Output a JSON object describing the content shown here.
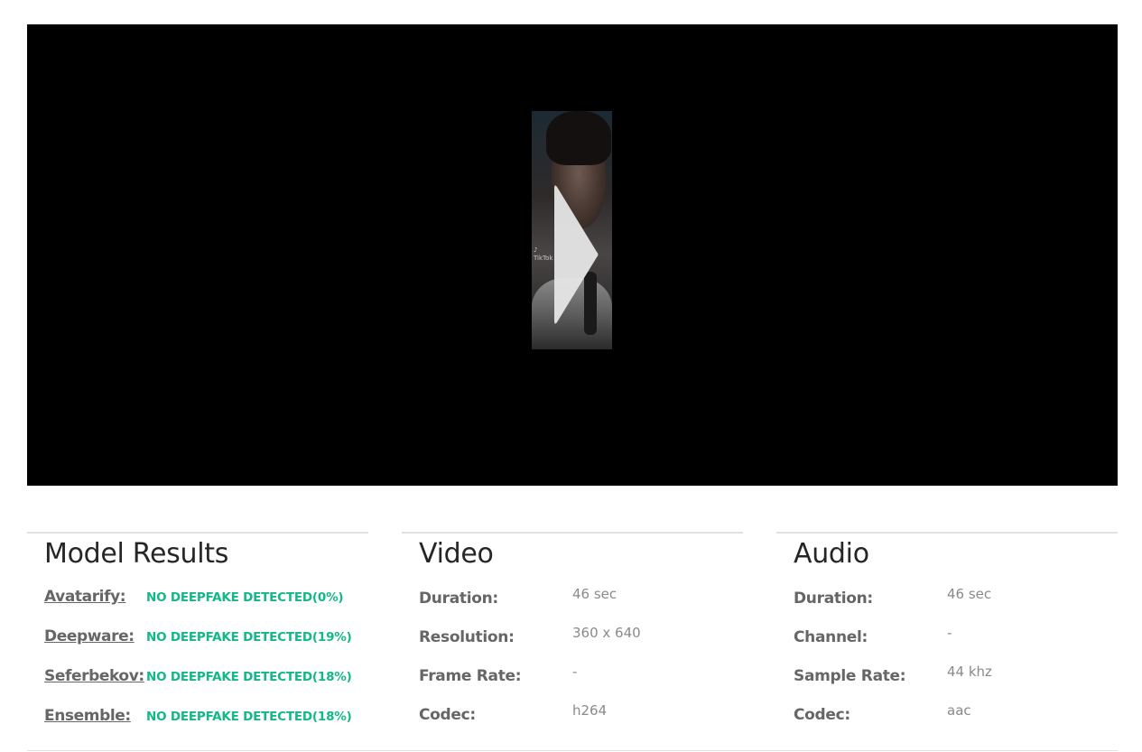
{
  "player": {
    "thumbnail_watermark": "♪\nTikTok",
    "play_icon": "play-triangle-icon"
  },
  "model_results": {
    "title": "Model Results",
    "items": [
      {
        "name": "Avatarify:",
        "verdict": "NO DEEPFAKE DETECTED(0%)"
      },
      {
        "name": "Deepware:",
        "verdict": "NO DEEPFAKE DETECTED(19%)"
      },
      {
        "name": "Seferbekov:",
        "verdict": "NO DEEPFAKE DETECTED(18%)"
      },
      {
        "name": "Ensemble:",
        "verdict": "NO DEEPFAKE DETECTED(18%)"
      }
    ]
  },
  "video": {
    "title": "Video",
    "rows": [
      {
        "label": "Duration:",
        "value": "46 sec"
      },
      {
        "label": "Resolution:",
        "value": "360 x 640"
      },
      {
        "label": "Frame Rate:",
        "value": "-"
      },
      {
        "label": "Codec:",
        "value": "h264"
      }
    ]
  },
  "audio": {
    "title": "Audio",
    "rows": [
      {
        "label": "Duration:",
        "value": "46 sec"
      },
      {
        "label": "Channel:",
        "value": "-"
      },
      {
        "label": "Sample Rate:",
        "value": "44 khz"
      },
      {
        "label": "Codec:",
        "value": "aac"
      }
    ]
  },
  "colors": {
    "verdict_ok": "#12b886",
    "heading": "#262626",
    "label": "#666666",
    "value": "#8a8a8a"
  }
}
